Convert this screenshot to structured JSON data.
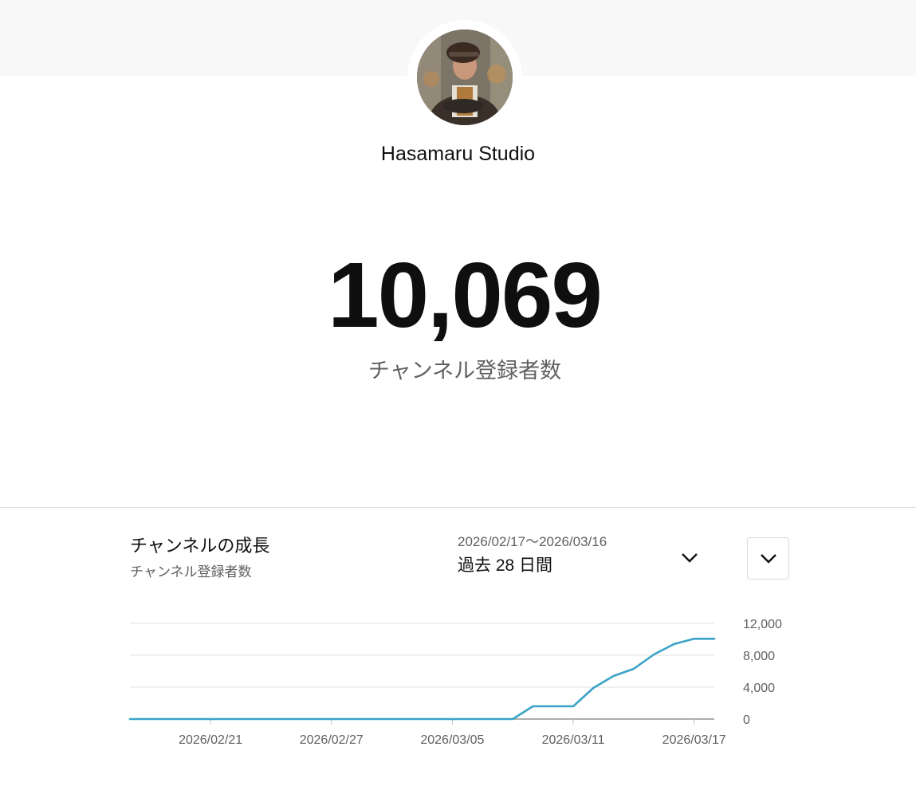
{
  "channel": {
    "name": "Hasamaru Studio",
    "subscriber_count": "10,069",
    "subscriber_label": "チャンネル登録者数"
  },
  "growth": {
    "title": "チャンネルの成長",
    "subtitle": "チャンネル登録者数",
    "range_dates": "2026/02/17〜2026/03/16",
    "range_label": "過去 28 日間"
  },
  "icons": {
    "range_toggle": "chevron-down-icon",
    "expand": "chevron-down-icon"
  },
  "colors": {
    "line": "#3ba3c6",
    "grid": "#e0e0e0",
    "axis": "#909090"
  },
  "chart_data": {
    "type": "line",
    "x_start": "2026/02/17",
    "x_end": "2026/03/18",
    "xticks": [
      "2026/02/21",
      "2026/02/27",
      "2026/03/05",
      "2026/03/11",
      "2026/03/17"
    ],
    "yticks": [
      "12,000",
      "8,000",
      "4,000",
      "0"
    ],
    "ylim": [
      0,
      12000
    ],
    "series": [
      {
        "points": [
          [
            "2026/02/17",
            0
          ],
          [
            "2026/02/18",
            0
          ],
          [
            "2026/02/19",
            0
          ],
          [
            "2026/02/20",
            0
          ],
          [
            "2026/02/21",
            0
          ],
          [
            "2026/02/22",
            0
          ],
          [
            "2026/02/23",
            0
          ],
          [
            "2026/02/24",
            0
          ],
          [
            "2026/02/25",
            0
          ],
          [
            "2026/02/26",
            0
          ],
          [
            "2026/02/27",
            0
          ],
          [
            "2026/02/28",
            0
          ],
          [
            "2026/03/01",
            0
          ],
          [
            "2026/03/02",
            0
          ],
          [
            "2026/03/03",
            0
          ],
          [
            "2026/03/04",
            0
          ],
          [
            "2026/03/05",
            0
          ],
          [
            "2026/03/06",
            0
          ],
          [
            "2026/03/07",
            0
          ],
          [
            "2026/03/08",
            0
          ],
          [
            "2026/03/09",
            1600
          ],
          [
            "2026/03/10",
            1600
          ],
          [
            "2026/03/11",
            1600
          ],
          [
            "2026/03/12",
            3900
          ],
          [
            "2026/03/13",
            5400
          ],
          [
            "2026/03/14",
            6300
          ],
          [
            "2026/03/15",
            8100
          ],
          [
            "2026/03/16",
            9400
          ],
          [
            "2026/03/17",
            10069
          ]
        ]
      }
    ]
  }
}
